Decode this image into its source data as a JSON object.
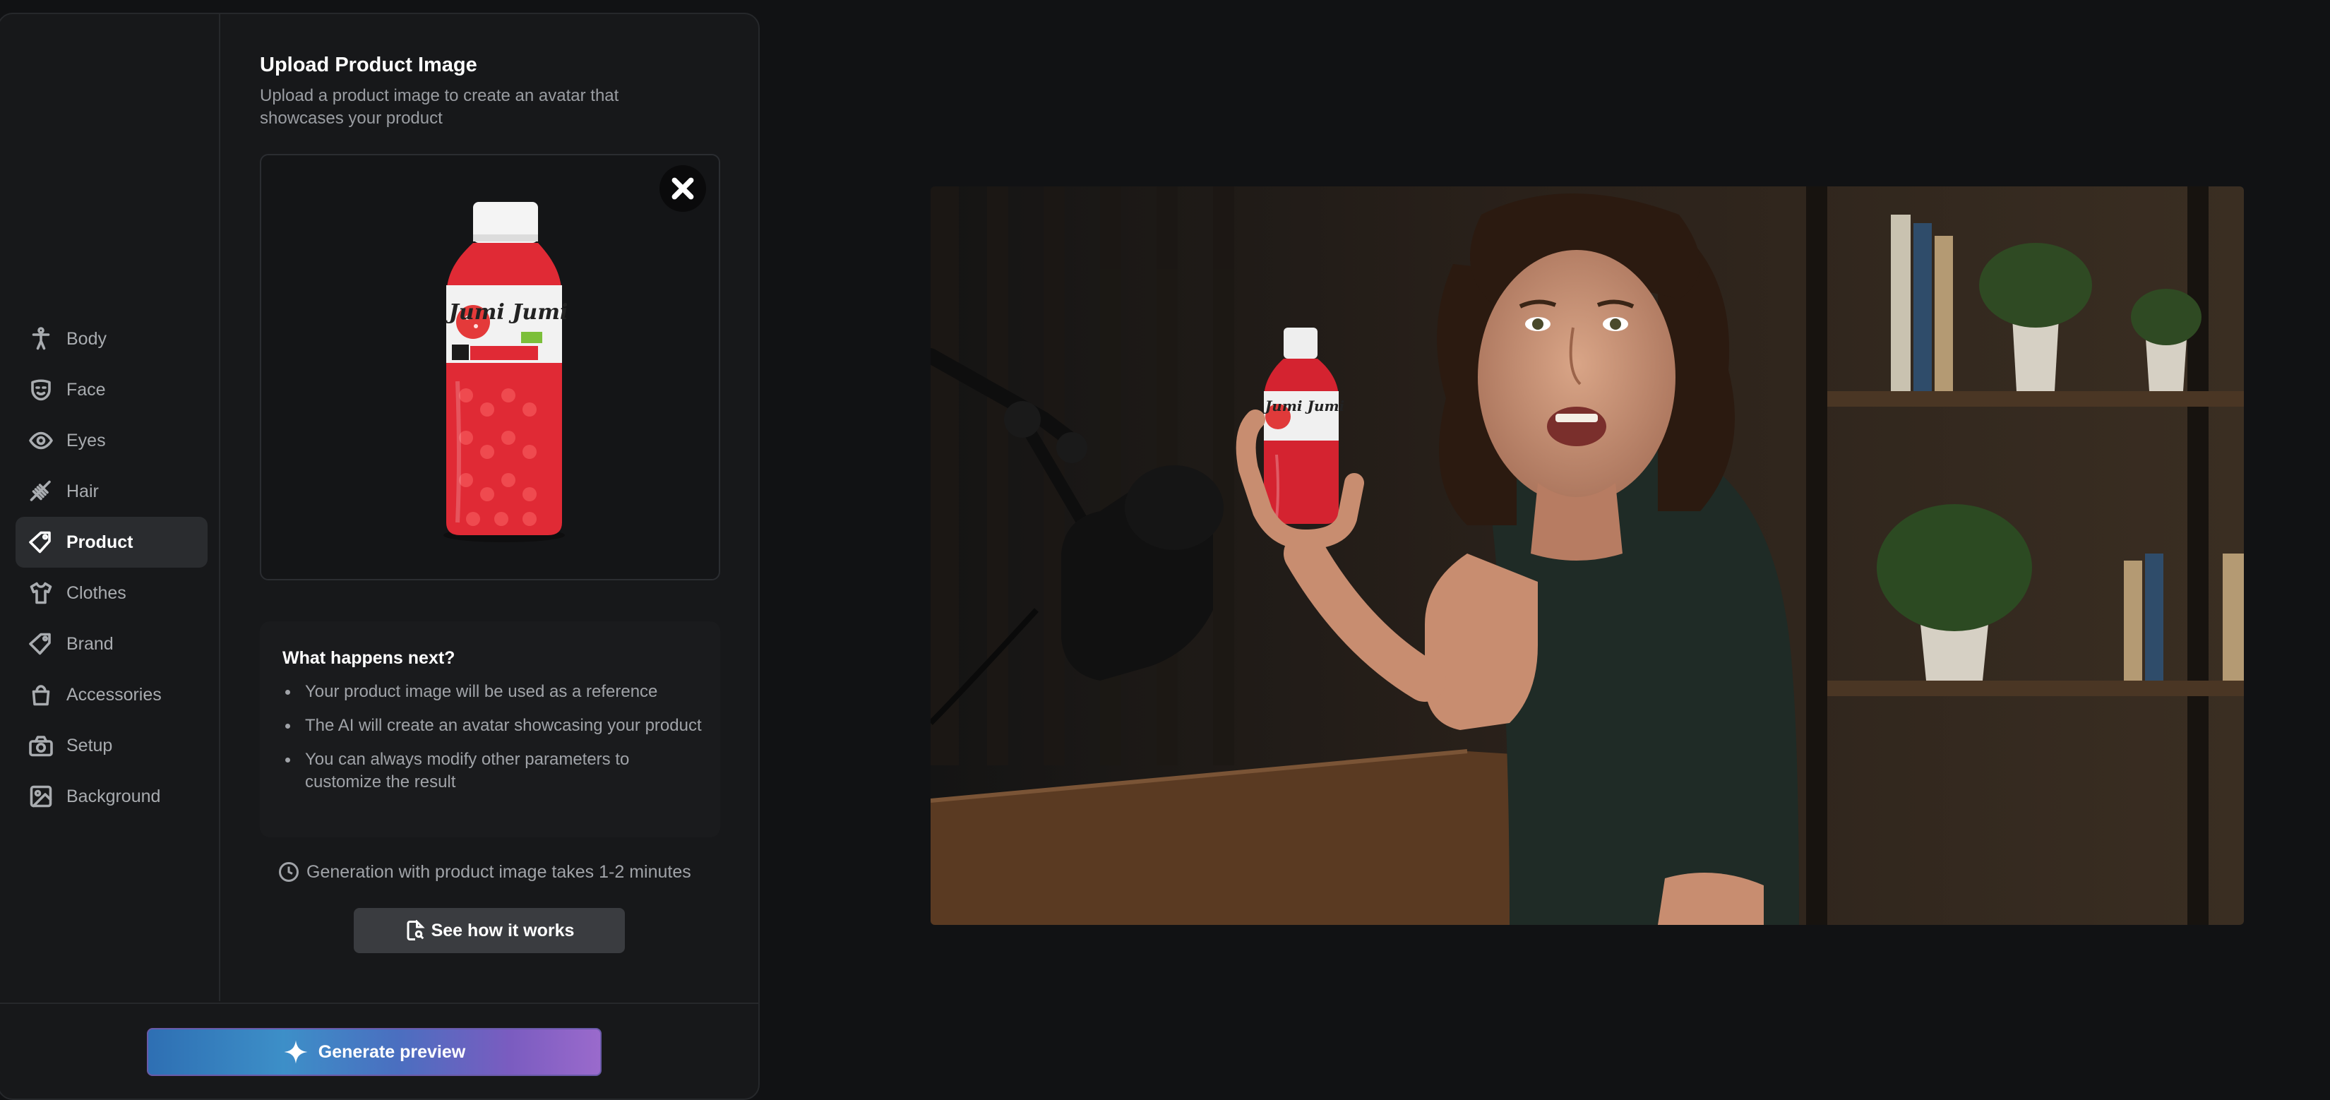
{
  "sidebar": {
    "items": [
      {
        "label": "Body",
        "icon": "body-icon",
        "active": false
      },
      {
        "label": "Face",
        "icon": "face-icon",
        "active": false
      },
      {
        "label": "Eyes",
        "icon": "eye-icon",
        "active": false
      },
      {
        "label": "Hair",
        "icon": "hair-icon",
        "active": false
      },
      {
        "label": "Product",
        "icon": "tag-icon",
        "active": true
      },
      {
        "label": "Clothes",
        "icon": "shirt-icon",
        "active": false
      },
      {
        "label": "Brand",
        "icon": "brand-tag-icon",
        "active": false
      },
      {
        "label": "Accessories",
        "icon": "bag-icon",
        "active": false
      },
      {
        "label": "Setup",
        "icon": "camera-icon",
        "active": false
      },
      {
        "label": "Background",
        "icon": "image-icon",
        "active": false
      }
    ]
  },
  "upload": {
    "title": "Upload Product Image",
    "subtitle": "Upload a product image to create an avatar that showcases your product",
    "product_label": "Jumi Jumi"
  },
  "next": {
    "title": "What happens next?",
    "items": [
      "Your product image will be used as a reference",
      "The AI will create an avatar showcasing your product",
      "You can always modify other parameters to customize the result"
    ]
  },
  "generation_time": "Generation with product image takes 1-2 minutes",
  "how_button": "See how it works",
  "generate_button": "Generate preview",
  "colors": {
    "background": "#111214",
    "panel": "#17181a",
    "active_item": "#2a2c2f",
    "accent_gradient_start": "#2e6fb3",
    "accent_gradient_end": "#9a6acc"
  }
}
